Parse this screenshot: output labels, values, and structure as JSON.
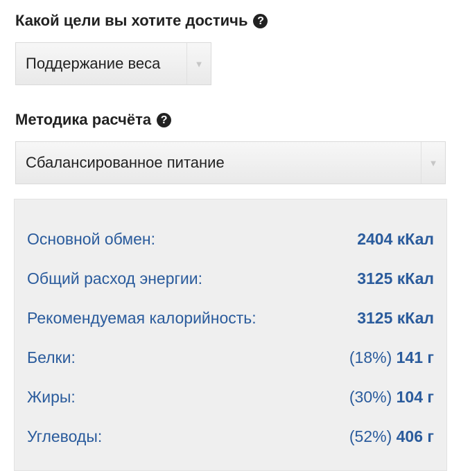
{
  "goal": {
    "title": "Какой цели вы хотите достичь",
    "help_icon": "question-circle-icon",
    "selected": "Поддержание веса",
    "arrow_icon": "chevron-down-icon"
  },
  "method": {
    "title": "Методика расчёта",
    "help_icon": "question-circle-icon",
    "selected": "Сбалансированное питание",
    "arrow_icon": "chevron-down-icon"
  },
  "results": [
    {
      "label": "Основной обмен:",
      "percent": "",
      "value": "2404 кКал"
    },
    {
      "label": "Общий расход энергии:",
      "percent": "",
      "value": "3125 кКал"
    },
    {
      "label": "Рекомендуемая калорийность:",
      "percent": "",
      "value": "3125 кКал"
    },
    {
      "label": "Белки:",
      "percent": "(18%)",
      "value": "141 г"
    },
    {
      "label": "Жиры:",
      "percent": "(30%)",
      "value": "104 г"
    },
    {
      "label": "Углеводы:",
      "percent": "(52%)",
      "value": "406 г"
    }
  ],
  "colors": {
    "accent": "#2a5b9c",
    "panel": "#efefef"
  }
}
